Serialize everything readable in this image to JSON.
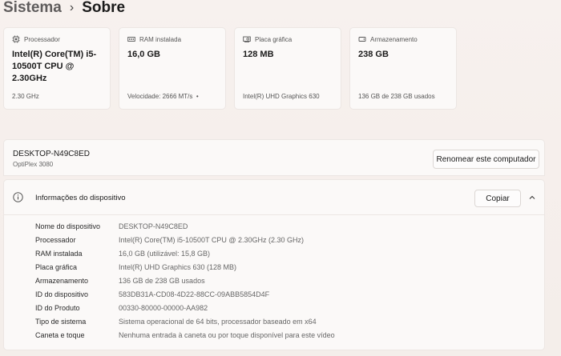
{
  "breadcrumb": {
    "parent": "Sistema",
    "separator": "›",
    "current": "Sobre"
  },
  "spec_cards": [
    {
      "title": "Processador",
      "icon": "processor-icon",
      "value": "Intel(R) Core(TM) i5-10500T CPU @ 2.30GHz",
      "footer": "2.30 GHz"
    },
    {
      "title": "RAM instalada",
      "icon": "ram-icon",
      "value": "16,0 GB",
      "footer": "Velocidade: 2666 MT/s"
    },
    {
      "title": "Placa gráfica",
      "icon": "graphics-card-icon",
      "value": "128 MB",
      "footer": "Intel(R) UHD Graphics 630"
    },
    {
      "title": "Armazenamento",
      "icon": "storage-icon",
      "value": "238 GB",
      "footer": "136 GB de 238 GB usados"
    }
  ],
  "device": {
    "name": "DESKTOP-N49C8ED",
    "model": "OptiPlex 3080",
    "rename_label": "Renomear este computador"
  },
  "device_info": {
    "title": "Informações do dispositivo",
    "copy_label": "Copiar",
    "rows": [
      {
        "label": "Nome do dispositivo",
        "value": "DESKTOP-N49C8ED"
      },
      {
        "label": "Processador",
        "value": "Intel(R) Core(TM) i5-10500T CPU @ 2.30GHz (2.30 GHz)"
      },
      {
        "label": "RAM instalada",
        "value": "16,0 GB (utilizável: 15,8 GB)"
      },
      {
        "label": "Placa gráfica",
        "value": "Intel(R) UHD Graphics 630 (128 MB)"
      },
      {
        "label": "Armazenamento",
        "value": "136 GB de 238 GB usados"
      },
      {
        "label": "ID do dispositivo",
        "value": "583DB31A-CD08-4D22-88CC-09ABB5854D4F"
      },
      {
        "label": "ID do Produto",
        "value": "00330-80000-00000-AA982"
      },
      {
        "label": "Tipo de sistema",
        "value": "Sistema operacional de 64 bits, processador baseado em x64"
      },
      {
        "label": "Caneta e toque",
        "value": "Nenhuma entrada à caneta ou por toque disponível para este vídeo"
      }
    ]
  },
  "colors": {
    "accent": "#1b1b1b",
    "card_bg": "#fbf9f8",
    "page_bg": "#f6efec"
  }
}
